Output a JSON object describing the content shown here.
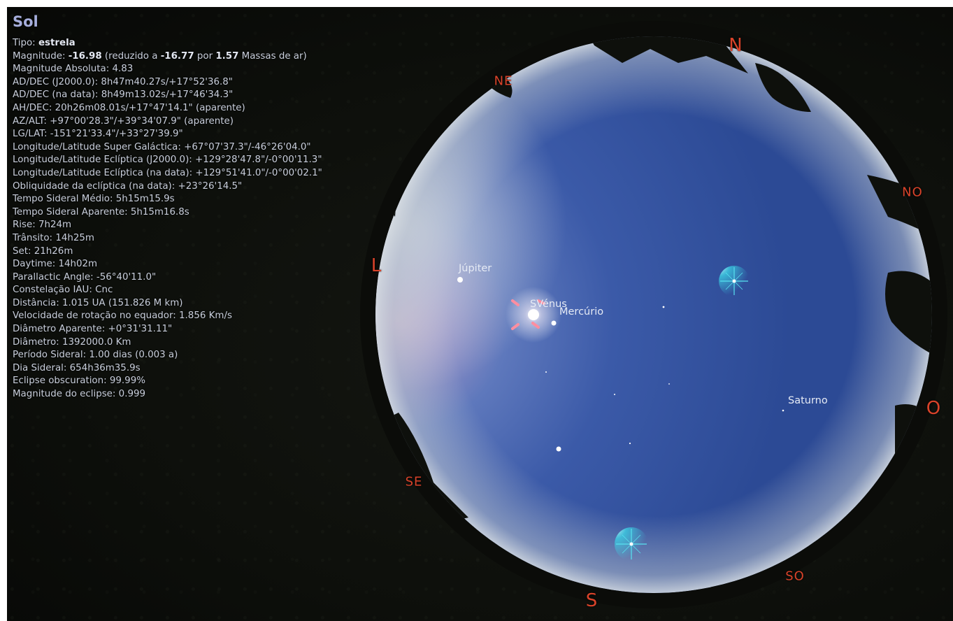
{
  "object": {
    "name": "Sol",
    "type_label": "Tipo: ",
    "type_value": "estrela",
    "magnitude_label": "Magnitude: ",
    "magnitude_value": "-16.98",
    "magnitude_mid1": " (reduzido a ",
    "magnitude_reduced": "-16.77",
    "magnitude_mid2": " por ",
    "airmass_value": "1.57",
    "magnitude_tail": " Massas de ar)",
    "lines": [
      "Magnitude Absoluta: 4.83",
      "AD/DEC (J2000.0): 8h47m40.27s/+17°52'36.8\"",
      "AD/DEC (na data): 8h49m13.02s/+17°46'34.3\"",
      "AH/DEC: 20h26m08.01s/+17°47'14.1\" (aparente)",
      "AZ/ALT: +97°00'28.3\"/+39°34'07.9\" (aparente)",
      "LG/LAT: -151°21'33.4\"/+33°27'39.9\"",
      "Longitude/Latitude Super Galáctica: +67°07'37.3\"/-46°26'04.0\"",
      "Longitude/Latitude Eclíptica (J2000.0): +129°28'47.8\"/-0°00'11.3\"",
      "Longitude/Latitude Eclíptica (na data): +129°51'41.0\"/-0°00'02.1\"",
      "Obliquidade da eclíptica (na data): +23°26'14.5\"",
      "Tempo Sideral Médio: 5h15m15.9s",
      "Tempo Sideral Aparente: 5h15m16.8s",
      "Rise: 7h24m",
      "Trânsito: 14h25m",
      "Set: 21h26m",
      "Daytime: 14h02m",
      "Parallactic Angle: -56°40'11.0\"",
      "Constelação IAU: Cnc",
      "Distância: 1.015 UA (151.826 M km)",
      "Velocidade de rotação no equador: 1.856 Km/s",
      "Diâmetro Aparente: +0°31'31.11\"",
      "Diâmetro: 1392000.0 Km",
      "Período Sideral: 1.00 dias (0.003 a)",
      "Dia Sideral: 654h36m35.9s",
      "Eclipse obscuration: 99.99%",
      "Magnitude do eclipse: 0.999"
    ]
  },
  "cardinals": {
    "n": "N",
    "ne": "NE",
    "l": "L",
    "se": "SE",
    "s": "S",
    "so": "SO",
    "o": "O",
    "no": "NO"
  },
  "planets": {
    "jupiter": "Júpiter",
    "sun_venus": "SVénus",
    "mercury": "Mercúrio",
    "saturn": "Saturno"
  },
  "colors": {
    "cardinal": "#d9432a",
    "title": "#a6aedc",
    "info_text": "#c9cfdc",
    "sky_center": "#3f59a5",
    "sky_edge": "#b9c1cc",
    "selection_marker": "#ff6b84"
  }
}
